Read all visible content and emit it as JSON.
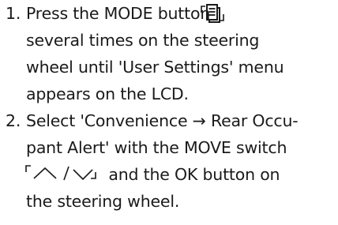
{
  "steps": [
    {
      "number": "1.",
      "lines": [
        "Press the MODE button",
        "several times on the steering",
        "wheel until 'User Settings' menu",
        "appears on the LCD."
      ],
      "icon": "mode-button-icon"
    },
    {
      "number": "2.",
      "lines": [
        "Select 'Convenience → Rear Occu-",
        "pant Alert' with the MOVE switch",
        "and the OK button on",
        "the steering wheel."
      ],
      "icon": "move-switch-icon"
    }
  ]
}
